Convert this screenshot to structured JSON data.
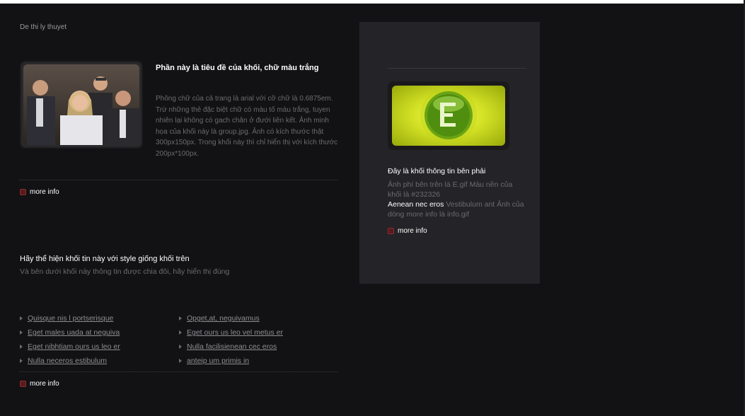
{
  "page": {
    "title": "De thi ly thuyet"
  },
  "block1": {
    "title": "Phần này là tiêu đề của khối, chữ màu trắng",
    "text": "Phông chữ của cả trang là arial với cỡ chữ là 0.6875em. Trừ những thẻ đặc biệt chữ có màu tố màu trắng, tuyen nhiên lại không có gach chân ở đưới liên kết. Ảnh minh họa của khối này là group.jpg. Ảnh có kích thước thật 300px150px. Trong khối này thì chỉ hiển thị với kích thước 200px*100px.",
    "more_label": "more info"
  },
  "block2": {
    "title": "Hãy thể hiện khối tin này với style giống khối trên",
    "subtitle": "Và bên dưới khối này thông tin được chia đôi, hãy hiển thị đúng",
    "links_left": [
      "Quisque nis l portserisque",
      "Eget males uada at neguiva",
      "Eget nibhtiam ours us leo er",
      "Nulla neceros estibulum"
    ],
    "links_right": [
      "Opget,at, neguivamus",
      "Eget ours us leo vel metus er",
      "Nulla facilisienean cec eros",
      "anteip um primis in"
    ],
    "more_label": "more info"
  },
  "panel": {
    "title": "Đây là khối thông tin bên phải",
    "text1": "Ảnh phí bên trên là E.gif Màu nền của khối là #232326",
    "strong": "Aenean nec eros",
    "text2": " Vestibulum ant Ảnh của dòng more info là info.gif",
    "more_label": "more info",
    "bg_color": "#232326"
  },
  "colors": {
    "page_bg": "#121113",
    "accent_green": "#d3e125",
    "more_icon": "#8a2d33"
  },
  "icons": [
    "info-icon",
    "bullet-arrow-icon",
    "e-logo-icon"
  ]
}
